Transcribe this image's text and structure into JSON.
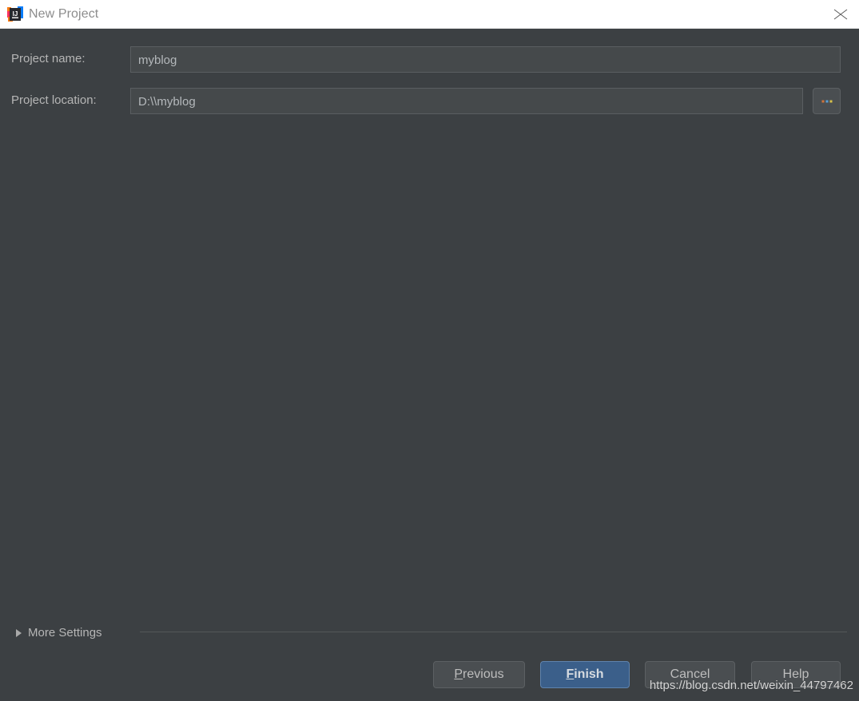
{
  "window": {
    "title": "New Project",
    "app_icon": "intellij-idea-icon",
    "close_icon": "close-icon",
    "titlebar_background": "#ffffff",
    "content_background": "#3c4043"
  },
  "form": {
    "fields": [
      {
        "label": "Project name:",
        "value": "myblog",
        "placeholder": "Project name"
      },
      {
        "label": "Project location:",
        "value": "D:\\\\myblog",
        "placeholder": "Project location"
      }
    ],
    "browse": {
      "icon": "ellipsis-icon",
      "label": "...",
      "dot_colors": [
        "#d0743c",
        "#5a9fd4",
        "#d8c24a"
      ]
    }
  },
  "more_settings": {
    "label": "More Settings",
    "expanded": false,
    "arrow_icon": "chevron-right-icon"
  },
  "buttons": [
    {
      "name": "previous",
      "label": "Previous",
      "mnemonic": "P",
      "primary": false
    },
    {
      "name": "finish",
      "label": "Finish",
      "mnemonic": "F",
      "primary": true
    },
    {
      "name": "cancel",
      "label": "Cancel",
      "mnemonic": "",
      "primary": false
    },
    {
      "name": "help",
      "label": "Help",
      "mnemonic": "",
      "primary": false
    }
  ],
  "button_labels": {
    "previous_prefix": "",
    "previous_mnemonic": "P",
    "previous_rest": "revious",
    "finish_mnemonic": "F",
    "finish_rest": "inish",
    "cancel": "Cancel",
    "help": "Help"
  },
  "watermark": {
    "text": "https://blog.csdn.net/weixin_44797462"
  },
  "colors": {
    "accent": "#3b5f8a",
    "field_background": "#45494b",
    "field_border": "#5a5e61",
    "text": "#b6b6b6"
  }
}
